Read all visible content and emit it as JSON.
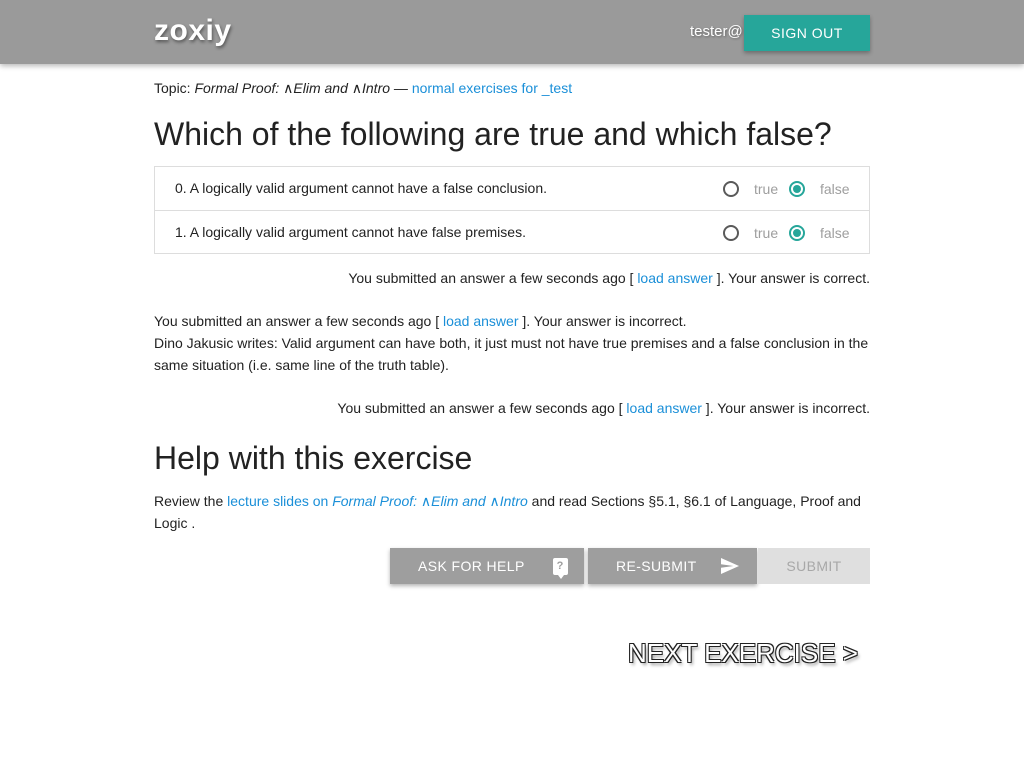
{
  "header": {
    "brand": "zoxiy",
    "user": "tester@",
    "signout_label": "SIGN OUT"
  },
  "topic": {
    "prefix": "Topic: ",
    "name": "Formal Proof: ∧Elim and ∧Intro",
    "separator": " — ",
    "link": "normal exercises for _test"
  },
  "question": {
    "title": "Which of the following are true and which false?",
    "items": [
      {
        "text": "0. A logically valid argument cannot have a false conclusion.",
        "true_label": "true",
        "false_label": "false",
        "selected": "false"
      },
      {
        "text": "1. A logically valid argument cannot have false premises.",
        "true_label": "true",
        "false_label": "false",
        "selected": "false"
      }
    ]
  },
  "feedback": [
    {
      "prefix": "You submitted an answer a few seconds ago [ ",
      "link": "load answer",
      "suffix": " ]. Your answer is correct.",
      "comment": ""
    },
    {
      "prefix": "You submitted an answer a few seconds ago [ ",
      "link": "load answer",
      "suffix": " ]. Your answer is incorrect.",
      "comment": "Dino Jakusic writes: Valid argument can have both, it just must not have true premises and a false conclusion in the same situation (i.e. same line of the truth table)."
    },
    {
      "prefix": "You submitted an answer a few seconds ago [ ",
      "link": "load answer",
      "suffix": " ]. Your answer is incorrect.",
      "comment": ""
    }
  ],
  "help": {
    "title": "Help with this exercise",
    "review_prefix": "Review the ",
    "link_prefix": "lecture slides on ",
    "link_topic": "Formal Proof: ∧Elim and ∧Intro",
    "review_suffix": " and read Sections §5.1, §6.1 of Language, Proof and Logic ."
  },
  "buttons": {
    "ask_help": "ASK FOR HELP",
    "ask_help_icon": "?",
    "resubmit": "RE-SUBMIT",
    "submit": "SUBMIT"
  },
  "next_label": "NEXT EXERCISE >",
  "colors": {
    "topbar": "#9a9a9a",
    "accent": "#26a69a",
    "link": "#1a8fd8",
    "button_grey": "#9e9e9e",
    "button_disabled": "#dfdfdf"
  },
  "icons": {
    "help": "question-bubble-icon",
    "resubmit": "send-icon"
  }
}
